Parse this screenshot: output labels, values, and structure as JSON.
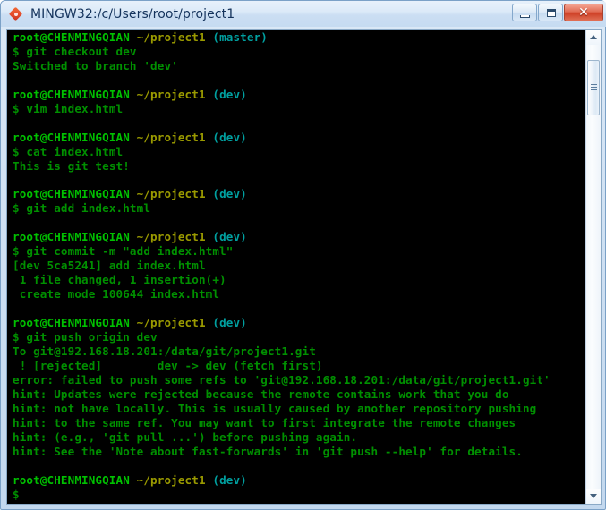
{
  "window": {
    "title": "MINGW32:/c/Users/root/project1",
    "icon": "git-bash-diamond-icon",
    "buttons": {
      "minimize": "Minimize",
      "maximize": "Maximize",
      "close": "✕"
    }
  },
  "scrollbar": {
    "up_arrow": "scroll-up",
    "down_arrow": "scroll-down",
    "thumb": "scroll-thumb"
  },
  "terminal": {
    "colors": {
      "background": "#000000",
      "user": "#00c000",
      "path": "#9a9a00",
      "branch": "#00a0a0",
      "output": "#009000"
    },
    "prompt": {
      "user_host": "root@CHENMINGQIAN",
      "path": "~/project1",
      "branch_master": "(master)",
      "branch_dev": "(dev)",
      "symbol": "$"
    },
    "blocks": [
      {
        "branch": "(master)",
        "command": "$ git checkout dev",
        "output": [
          "Switched to branch 'dev'"
        ]
      },
      {
        "branch": "(dev)",
        "command": "$ vim index.html",
        "output": []
      },
      {
        "branch": "(dev)",
        "command": "$ cat index.html",
        "output": [
          "This is git test!"
        ]
      },
      {
        "branch": "(dev)",
        "command": "$ git add index.html",
        "output": []
      },
      {
        "branch": "(dev)",
        "command": "$ git commit -m \"add index.html\"",
        "output": [
          "[dev 5ca5241] add index.html",
          " 1 file changed, 1 insertion(+)",
          " create mode 100644 index.html"
        ]
      },
      {
        "branch": "(dev)",
        "command": "$ git push origin dev",
        "output": [
          "To git@192.168.18.201:/data/git/project1.git",
          " ! [rejected]        dev -> dev (fetch first)",
          "error: failed to push some refs to 'git@192.168.18.201:/data/git/project1.git'",
          "hint: Updates were rejected because the remote contains work that you do",
          "hint: not have locally. This is usually caused by another repository pushing",
          "hint: to the same ref. You may want to first integrate the remote changes",
          "hint: (e.g., 'git pull ...') before pushing again.",
          "hint: See the 'Note about fast-forwards' in 'git push --help' for details."
        ]
      },
      {
        "branch": "(dev)",
        "command": "$",
        "output": []
      }
    ]
  }
}
